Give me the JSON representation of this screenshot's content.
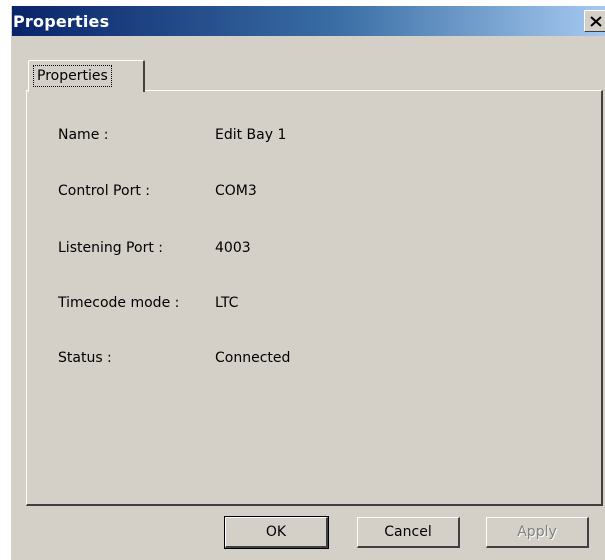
{
  "window": {
    "title": "Properties",
    "close_symbol": "X"
  },
  "tabs": [
    {
      "label": "Properties",
      "selected": true
    }
  ],
  "properties": [
    {
      "label": "Name :",
      "value": "Edit Bay 1"
    },
    {
      "label": "Control Port :",
      "value": "COM3"
    },
    {
      "label": "Listening Port :",
      "value": "4003"
    },
    {
      "label": "Timecode mode :",
      "value": "LTC"
    },
    {
      "label": "Status :",
      "value": "Connected"
    }
  ],
  "buttons": {
    "ok": "OK",
    "cancel": "Cancel",
    "apply": "Apply",
    "apply_enabled": false
  },
  "colors": {
    "titlebar_start": "#0a246a",
    "titlebar_end": "#a6caf0",
    "face": "#d4d0c8"
  }
}
